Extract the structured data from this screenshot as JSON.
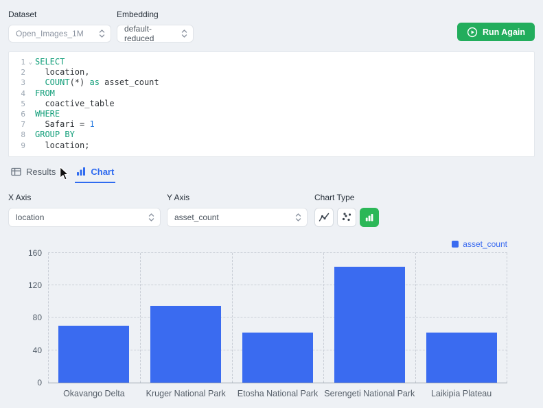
{
  "accent": {
    "green": "#22ad5c",
    "blue": "#2f6bf0",
    "bar_blue": "#3a6bf0"
  },
  "header": {
    "dataset": {
      "label": "Dataset",
      "value": "Open_Images_1M"
    },
    "embedding": {
      "label": "Embedding",
      "value": "default-reduced"
    },
    "run_button": {
      "label": "Run Again"
    }
  },
  "editor": {
    "lines": [
      {
        "num": "1",
        "fold": true,
        "segments": [
          {
            "t": "SELECT",
            "c": "kw"
          }
        ]
      },
      {
        "num": "2",
        "segments": [
          {
            "t": "  location,",
            "c": "pl"
          }
        ]
      },
      {
        "num": "3",
        "segments": [
          {
            "t": "  ",
            "c": "pl"
          },
          {
            "t": "COUNT",
            "c": "kw"
          },
          {
            "t": "(*) ",
            "c": "pl"
          },
          {
            "t": "as",
            "c": "kw"
          },
          {
            "t": " asset_count",
            "c": "pl"
          }
        ]
      },
      {
        "num": "4",
        "segments": [
          {
            "t": "FROM",
            "c": "kw"
          }
        ]
      },
      {
        "num": "5",
        "segments": [
          {
            "t": "  coactive_table",
            "c": "pl"
          }
        ]
      },
      {
        "num": "6",
        "segments": [
          {
            "t": "WHERE",
            "c": "kw"
          }
        ]
      },
      {
        "num": "7",
        "segments": [
          {
            "t": "  Safari = ",
            "c": "pl"
          },
          {
            "t": "1",
            "c": "num"
          }
        ]
      },
      {
        "num": "8",
        "segments": [
          {
            "t": "GROUP BY",
            "c": "kw"
          }
        ]
      },
      {
        "num": "9",
        "segments": [
          {
            "t": "  location;",
            "c": "pl"
          }
        ]
      }
    ]
  },
  "tabs": {
    "results": "Results",
    "chart": "Chart",
    "active": "chart"
  },
  "controls": {
    "x_axis": {
      "label": "X Axis",
      "value": "location"
    },
    "y_axis": {
      "label": "Y Axis",
      "value": "asset_count"
    },
    "chart_type": {
      "label": "Chart Type",
      "options": [
        "line",
        "scatter",
        "bar"
      ],
      "selected": "bar"
    }
  },
  "chart_data": {
    "type": "bar",
    "title": "",
    "categories": [
      "Okavango Delta",
      "Kruger National Park",
      "Etosha National Park",
      "Serengeti National Park",
      "Laikipia Plateau"
    ],
    "series": [
      {
        "name": "asset_count",
        "values": [
          70,
          95,
          62,
          143,
          62
        ]
      }
    ],
    "xlabel": "location",
    "ylabel": "asset_count",
    "ylim": [
      0,
      160
    ],
    "yticks": [
      0,
      40,
      80,
      120,
      160
    ],
    "grid": "dashed",
    "legend_position": "top-right",
    "bar_color": "#3a6bf0"
  }
}
